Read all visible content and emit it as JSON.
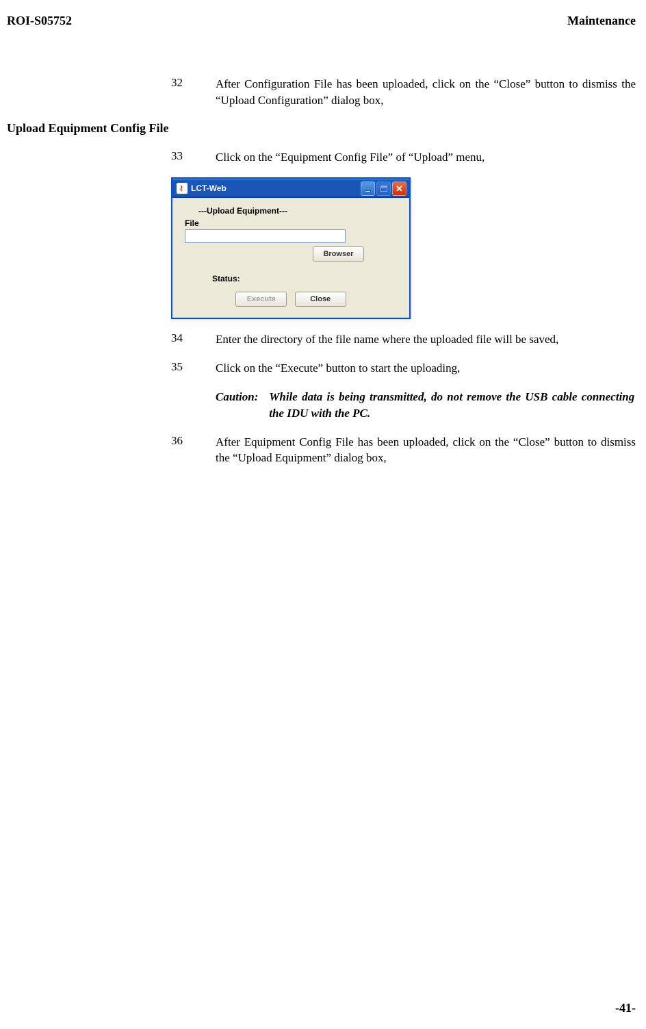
{
  "header": {
    "doc_id": "ROI-S05752",
    "section": "Maintenance"
  },
  "steps": {
    "s32": {
      "num": "32",
      "text": "After Configuration File has been uploaded, click on the “Close” button to dismiss the “Upload Configuration” dialog box,"
    },
    "heading": "Upload Equipment Config File",
    "s33": {
      "num": "33",
      "text": "Click on the “Equipment Config File” of “Upload” menu,"
    },
    "s34": {
      "num": "34",
      "text": "Enter the directory of the file name where the uploaded file will be saved,"
    },
    "s35": {
      "num": "35",
      "text": "Click on the “Execute” button to start the uploading,"
    },
    "caution": {
      "label": "Caution:",
      "text": "While data is being transmitted, do not remove the USB cable connecting the IDU with the PC."
    },
    "s36": {
      "num": "36",
      "text": "After Equipment Config File has been uploaded, click on the “Close” button to dismiss the “Upload Equipment” dialog box,"
    }
  },
  "dialog": {
    "title": "LCT-Web",
    "heading": "---Upload Equipment---",
    "file_label": "File",
    "file_value": "",
    "browser_btn": "Browser",
    "status_label": "Status:",
    "execute_btn": "Execute",
    "close_btn": "Close"
  },
  "page_number": "-41-"
}
